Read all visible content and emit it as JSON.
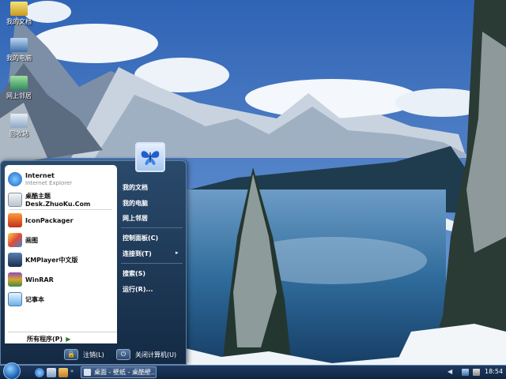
{
  "desktop": {
    "icons": [
      {
        "label": "我的文档",
        "icon": "documents-folder-icon"
      },
      {
        "label": "我的电脑",
        "icon": "computer-icon"
      },
      {
        "label": "网上邻居",
        "icon": "network-icon"
      },
      {
        "label": "回收站",
        "icon": "recycle-bin-icon"
      }
    ]
  },
  "start_menu": {
    "pinned": [
      {
        "label": "Internet",
        "sublabel": "Internet Explorer",
        "icon": "internet-explorer-icon"
      },
      {
        "label": "桌酷主题Desk.ZhuoKu.Com",
        "icon": "zhuoku-theme-icon"
      }
    ],
    "recent": [
      {
        "label": "IconPackager",
        "icon": "iconpackager-icon"
      },
      {
        "label": "画图",
        "icon": "paint-icon"
      },
      {
        "label": "KMPlayer中文版",
        "icon": "kmplayer-icon"
      },
      {
        "label": "WinRAR",
        "icon": "winrar-icon"
      },
      {
        "label": "记事本",
        "icon": "notepad-icon"
      }
    ],
    "all_programs": "所有程序(P)",
    "places": [
      {
        "label": "我的文档"
      },
      {
        "label": "我的电脑"
      },
      {
        "label": "网上邻居"
      }
    ],
    "system": [
      {
        "label": "控制面板(C)"
      },
      {
        "label": "连接到(T)",
        "arrow": "▸"
      }
    ],
    "help": [
      {
        "label": "搜索(S)"
      },
      {
        "label": "运行(R)..."
      }
    ],
    "logoff": "注销(L)",
    "shutdown": "关闭计算机(U)"
  },
  "taskbar": {
    "task_label": "桌面 - 壁纸 - 桌酷壁...",
    "tray_arrow": "◀",
    "clock": "18:54"
  },
  "colors": {
    "accent": "#2a4a6c",
    "taskbar": "#1e3a60"
  }
}
